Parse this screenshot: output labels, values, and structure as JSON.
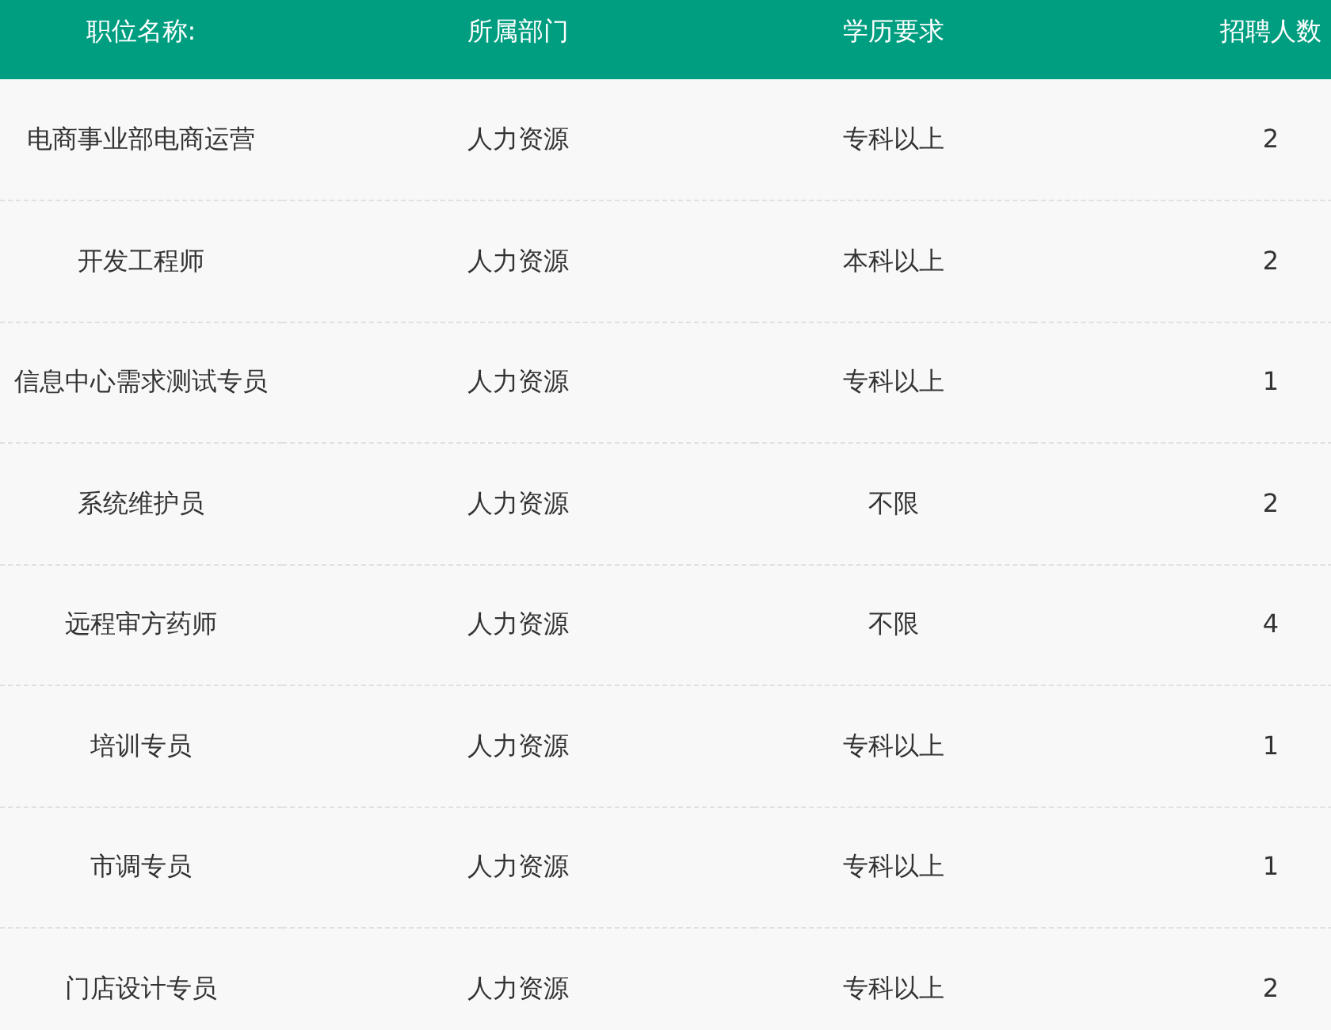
{
  "table": {
    "columns": [
      "职位名称:",
      "所属部门",
      "学历要求",
      "招聘人数"
    ],
    "rows": [
      [
        "电商事业部电商运营",
        "人力资源",
        "专科以上",
        "2"
      ],
      [
        "开发工程师",
        "人力资源",
        "本科以上",
        "2"
      ],
      [
        "信息中心需求测试专员",
        "人力资源",
        "专科以上",
        "1"
      ],
      [
        "系统维护员",
        "人力资源",
        "不限",
        "2"
      ],
      [
        "远程审方药师",
        "人力资源",
        "不限",
        "4"
      ],
      [
        "培训专员",
        "人力资源",
        "专科以上",
        "1"
      ],
      [
        "市调专员",
        "人力资源",
        "专科以上",
        "1"
      ],
      [
        "门店设计专员",
        "人力资源",
        "专科以上",
        "2"
      ]
    ]
  }
}
